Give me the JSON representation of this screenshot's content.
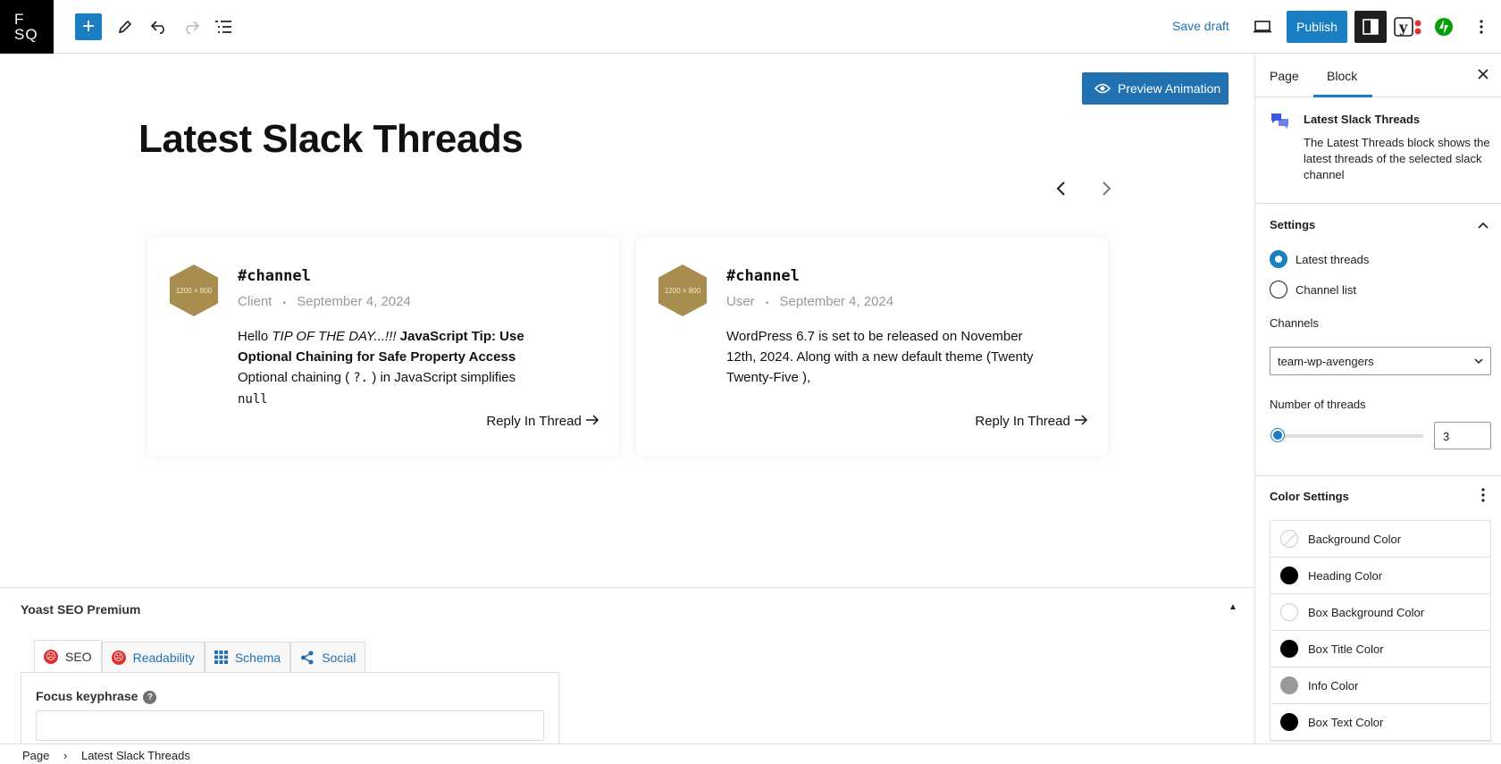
{
  "topbar": {
    "logo_line1": "F",
    "logo_line2": "SQ",
    "save_draft": "Save draft",
    "publish": "Publish"
  },
  "canvas": {
    "preview_button": "Preview Animation",
    "title": "Latest Slack Threads",
    "cards": [
      {
        "channel": "#channel",
        "author": "Client",
        "date": "September 4, 2024",
        "body_hello": "Hello ",
        "body_italic": "TIP OF THE DAY...!!!",
        "body_bold": "JavaScript Tip: Use Optional Chaining for Safe Property Access",
        "body_text1": "Optional chaining ( ",
        "body_code1": "?.",
        "body_text2": " ) in JavaScript simplifies",
        "body_code2": "null",
        "reply": "Reply In Thread"
      },
      {
        "channel": "#channel",
        "author": "User",
        "date": "September 4, 2024",
        "body": "WordPress 6.7 is set to be released on November 12th, 2024. Along with a new default theme (Twenty Twenty-Five ),",
        "reply": "Reply In Thread"
      }
    ],
    "placeholder_image_text": "1200 × 800",
    "placeholder_color": "#a88d4e"
  },
  "yoast": {
    "title": "Yoast SEO Premium",
    "tabs": [
      "SEO",
      "Readability",
      "Schema",
      "Social"
    ],
    "focus_label": "Focus keyphrase",
    "help_glyph": "?"
  },
  "footer": {
    "crumb1": "Page",
    "crumb2": "Latest Slack Threads"
  },
  "sidebar": {
    "tab_page": "Page",
    "tab_block": "Block",
    "block_name": "Latest Slack Threads",
    "block_desc": "The Latest Threads block shows the latest threads of the selected slack channel",
    "settings_title": "Settings",
    "radio_latest": "Latest threads",
    "radio_channel": "Channel list",
    "channels_label": "Channels",
    "channels_value": "team-wp-avengers",
    "threads_label": "Number of threads",
    "threads_value": "3",
    "threads_fraction": 0.04,
    "color_title": "Color Settings",
    "colors": [
      {
        "label": "Background Color",
        "swatch": "none"
      },
      {
        "label": "Heading Color",
        "swatch": "#000000"
      },
      {
        "label": "Box Background Color",
        "swatch": "#ffffff"
      },
      {
        "label": "Box Title Color",
        "swatch": "#000000"
      },
      {
        "label": "Info Color",
        "swatch": "#999999"
      },
      {
        "label": "Box Text Color",
        "swatch": "#000000"
      }
    ]
  },
  "accent": "#1a7ec2"
}
